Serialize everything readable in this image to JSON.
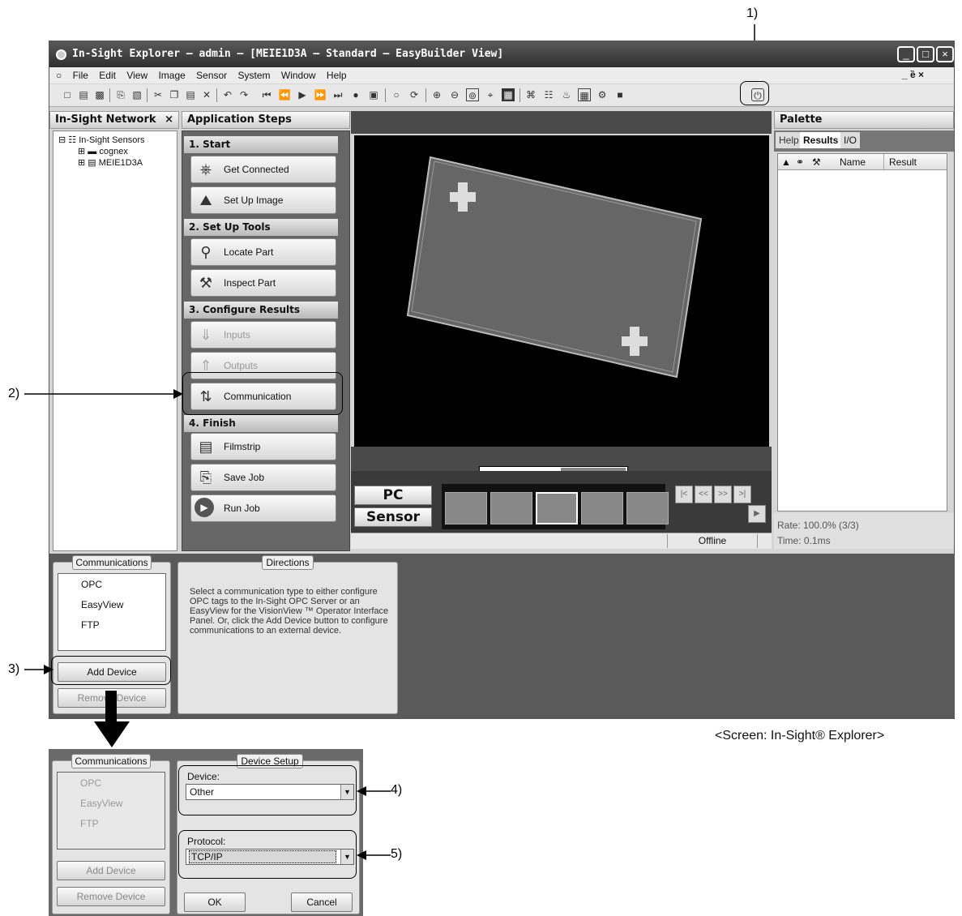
{
  "window": {
    "title": "In-Sight Explorer – admin – [MEIE1D3A – Standard – EasyBuilder View]",
    "controls": [
      "_",
      "□",
      "×"
    ]
  },
  "menu": {
    "items": [
      "File",
      "Edit",
      "View",
      "Image",
      "Sensor",
      "System",
      "Window",
      "Help"
    ],
    "mdi_controls": "_ ȅ ×"
  },
  "network": {
    "header": "In-Sight Network",
    "close": "×",
    "tree": [
      "In-Sight Sensors",
      "cognex",
      "MEIE1D3A"
    ]
  },
  "steps": {
    "header": "Application Steps",
    "sections": [
      "1. Start",
      "2. Set Up Tools",
      "3. Configure Results",
      "4. Finish"
    ],
    "buttons": [
      "Get Connected",
      "Set Up Image",
      "Locate Part",
      "Inspect Part",
      "Inputs",
      "Outputs",
      "Communication",
      "Filmstrip",
      "Save Job",
      "Run Job"
    ]
  },
  "view": {
    "pc_label": "PC",
    "sensor_label": "Sensor",
    "status": "Offline"
  },
  "palette": {
    "header": "Palette",
    "tabs": [
      "Help",
      "Results",
      "I/O"
    ],
    "columns": [
      "Name",
      "Result"
    ],
    "rate": "Rate: 100.0% (3/3)",
    "time": "Time: 0.1ms"
  },
  "communications": {
    "legend": "Communications",
    "items": [
      "OPC",
      "EasyView",
      "FTP"
    ],
    "add_device": "Add Device",
    "remove_device": "Remove Device"
  },
  "directions": {
    "legend": "Directions",
    "text": "Select a communication type to either configure OPC tags to the In-Sight OPC Server or an EasyView for the VisionView ™ Operator Interface Panel. Or, click the Add Device button to configure communications to an external device."
  },
  "device_setup": {
    "legend": "Device Setup",
    "device_label": "Device:",
    "device_value": "Other",
    "protocol_label": "Protocol:",
    "protocol_value": "TCP/IP",
    "ok": "OK",
    "cancel": "Cancel"
  },
  "callouts": [
    "1)",
    "2)",
    "3)",
    "4)",
    "5)"
  ],
  "caption": "<Screen: In-Sight® Explorer>"
}
